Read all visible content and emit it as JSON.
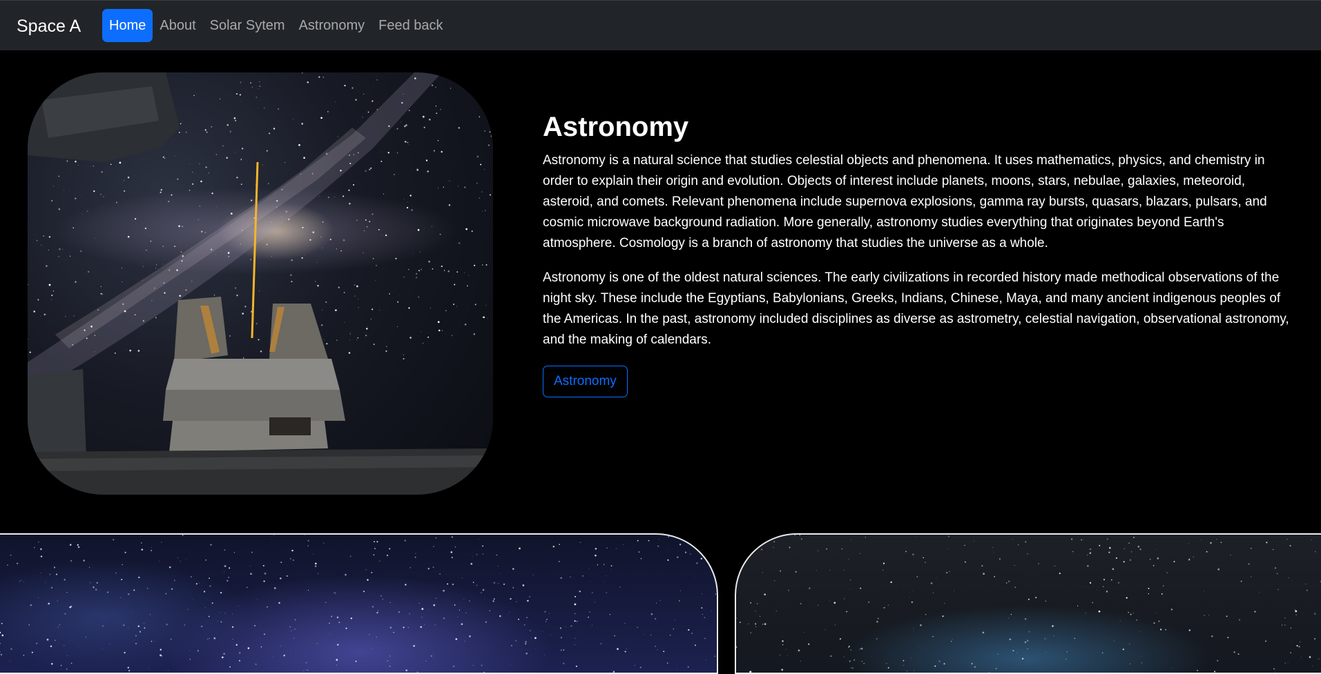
{
  "navbar": {
    "brand": "Space A",
    "links": [
      {
        "label": "Home",
        "active": true
      },
      {
        "label": "About",
        "active": false
      },
      {
        "label": "Solar Sytem",
        "active": false
      },
      {
        "label": "Astronomy",
        "active": false
      },
      {
        "label": "Feed back",
        "active": false
      }
    ]
  },
  "main": {
    "title": "Astronomy",
    "paragraphs": [
      "Astronomy is a natural science that studies celestial objects and phenomena. It uses mathematics, physics, and chemistry in order to explain their origin and evolution. Objects of interest include planets, moons, stars, nebulae, galaxies, meteoroid, asteroid, and comets. Relevant phenomena include supernova explosions, gamma ray bursts, quasars, blazars, pulsars, and cosmic microwave background radiation. More generally, astronomy studies everything that originates beyond Earth's atmosphere. Cosmology is a branch of astronomy that studies the universe as a whole.",
      "Astronomy is one of the oldest natural sciences. The early civilizations in recorded history made methodical observations of the night sky. These include the Egyptians, Babylonians, Greeks, Indians, Chinese, Maya, and many ancient indigenous peoples of the Americas. In the past, astronomy included disciplines as diverse as astrometry, celestial navigation, observational astronomy, and the making of calendars."
    ],
    "button_label": "Astronomy"
  },
  "colors": {
    "navbar_bg": "#212529",
    "accent": "#0d6efd",
    "page_bg": "#000000"
  }
}
